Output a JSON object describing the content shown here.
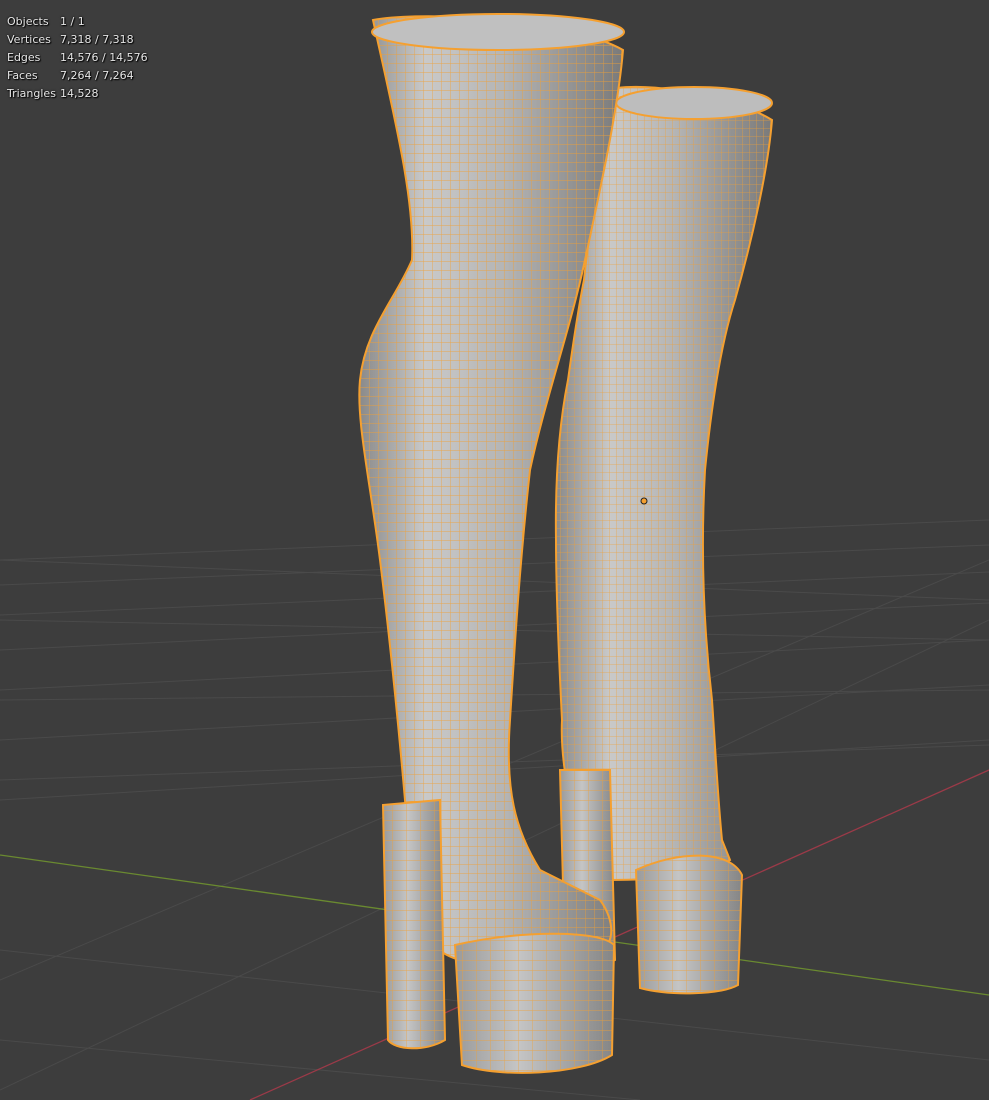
{
  "app": "Blender 3D Viewport",
  "overlay_stats": [
    {
      "label": "Objects",
      "value": "1 / 1"
    },
    {
      "label": "Vertices",
      "value": "7,318 / 7,318"
    },
    {
      "label": "Edges",
      "value": "14,576 / 14,576"
    },
    {
      "label": "Faces",
      "value": "7,264 / 7,264"
    },
    {
      "label": "Triangles",
      "value": "14,528"
    }
  ],
  "colors": {
    "background": "#3d3d3d",
    "grid_line": "#4a4a4a",
    "x_axis": "#9b3a48",
    "y_axis": "#6a8a30",
    "mesh_fill": "#b8b8b8",
    "wireframe": "#f5a030",
    "origin_dot": "#f5a030"
  },
  "selected_object": "boots-mesh"
}
